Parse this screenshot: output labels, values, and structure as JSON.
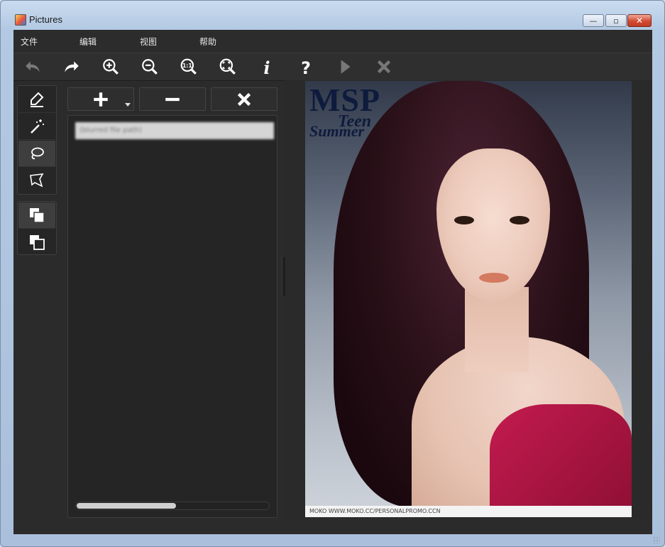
{
  "window": {
    "title": "Pictures"
  },
  "menu": {
    "items": [
      "文件",
      "编辑",
      "视图",
      "帮助"
    ]
  },
  "toolbar": {
    "buttons": [
      "undo-icon",
      "redo-icon",
      "zoom-in-icon",
      "zoom-out-icon",
      "actual-size-icon",
      "fit-screen-icon",
      "info-icon",
      "help-icon",
      "play-icon",
      "close-icon"
    ],
    "actual_size_label": "1:1",
    "info_label": "i",
    "help_label": "?"
  },
  "tools": {
    "group1": [
      "eraser-icon",
      "magic-wand-icon",
      "lasso-icon",
      "polygon-lasso-icon"
    ],
    "group2": [
      "layer-front-icon",
      "layer-back-icon"
    ],
    "active": "lasso-icon"
  },
  "list_panel": {
    "buttons": [
      "add-icon",
      "remove-icon",
      "clear-icon"
    ],
    "files": [
      "(blurred file path)"
    ],
    "scroll_fraction": 0.5
  },
  "image": {
    "title_text": "MSP",
    "teen_text": "Teen",
    "summer_text": "Summer",
    "footer_text": "MOKO  WWW.MOKO.CC/PERSONALPROMO.CCN"
  },
  "colors": {
    "client_bg": "#2b2b2b",
    "titlebar": "#b3c9e3",
    "dress": "#c31b4f"
  }
}
